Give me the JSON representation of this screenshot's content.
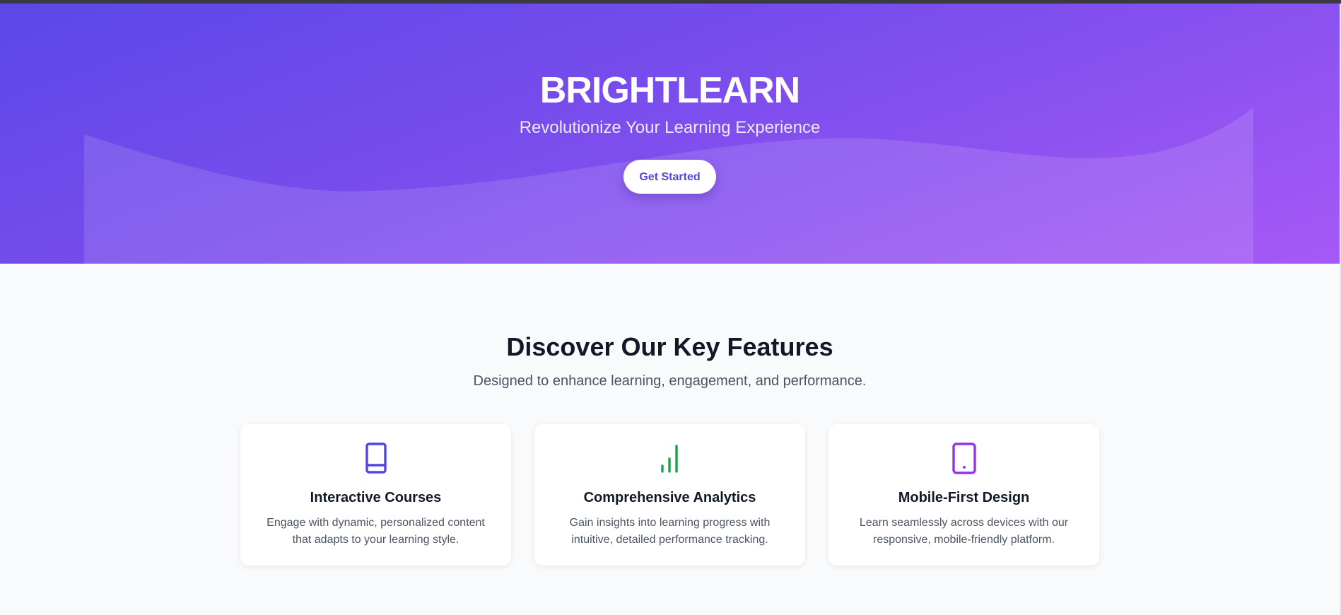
{
  "hero": {
    "brand": "BRIGHTLEARN",
    "tagline": "Revolutionize Your Learning Experience",
    "cta_label": "Get Started"
  },
  "features": {
    "heading": "Discover Our Key Features",
    "subheading": "Designed to enhance learning, engagement, and performance.",
    "cards": [
      {
        "icon": "book-icon",
        "icon_color": "#4f46e5",
        "title": "Interactive Courses",
        "description": "Engage with dynamic, personalized content that adapts to your learning style."
      },
      {
        "icon": "bar-chart-icon",
        "icon_color": "#16a34a",
        "title": "Comprehensive Analytics",
        "description": "Gain insights into learning progress with intuitive, detailed performance tracking."
      },
      {
        "icon": "tablet-icon",
        "icon_color": "#9333ea",
        "title": "Mobile-First Design",
        "description": "Learn seamlessly across devices with our responsive, mobile-friendly platform."
      }
    ]
  },
  "colors": {
    "hero_gradient_start": "#5b47e8",
    "hero_gradient_end": "#a659f6",
    "cta_text": "#4f46e5",
    "page_background": "#f9fafb",
    "heading_text": "#111827",
    "body_text": "#4b5563"
  }
}
